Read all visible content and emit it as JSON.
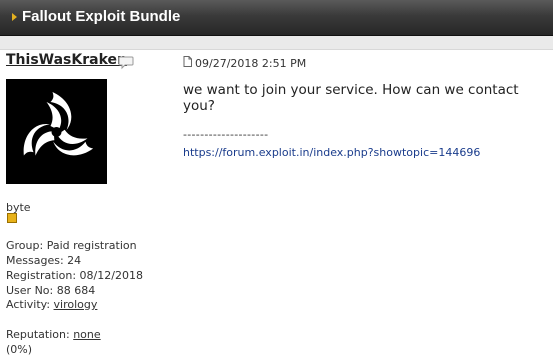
{
  "header": {
    "title": "Fallout Exploit Bundle"
  },
  "post": {
    "username": "ThisWasKraken",
    "date": "09/27/2018 2:51 PM",
    "message": "we want to join your service. How can we contact you?",
    "signature_separator": "--------------------",
    "signature_link": "https://forum.exploit.in/index.php?showtopic=144696"
  },
  "user": {
    "rank": "byte",
    "group": "Group: Paid registration",
    "messages": "Messages: 24",
    "registration": "Registration: 08/12/2018",
    "user_no": "User No: 88 684",
    "activity_label": "Activity:",
    "activity_value": "virology",
    "reputation_label": "Reputation:",
    "reputation_value": "none",
    "reputation_percent": "(0%)"
  },
  "icons": {
    "title_marker": "arrow-right-icon",
    "pm": "speech-bubble-icon",
    "post": "document-icon",
    "avatar": "triquetra-logo"
  },
  "colors": {
    "title_bar": "#3a3a3a",
    "accent": "#e8b21a",
    "link": "#1a3c8c"
  }
}
